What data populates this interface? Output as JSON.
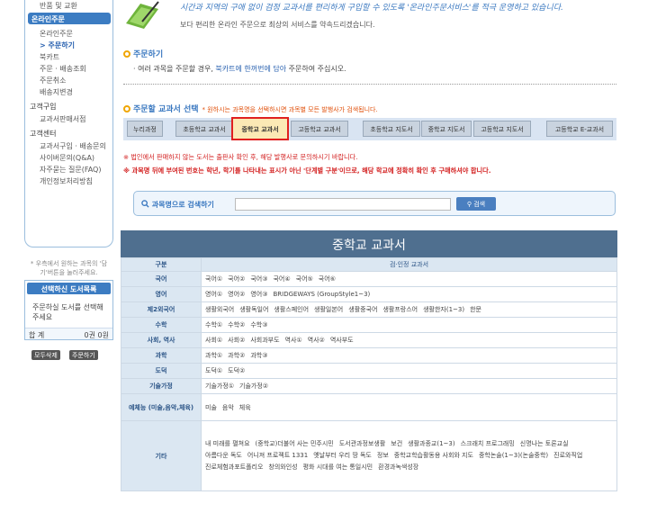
{
  "sidebar": {
    "top_label": "반품 및 교환",
    "section1": "온라인주문",
    "sub1": [
      "온라인주문",
      "> 주문하기",
      "북카트",
      "주문 · 배송조회",
      "주문취소",
      "배송지변경"
    ],
    "section2": "고객구입",
    "sub2": [
      "교과서판매서점"
    ],
    "section3": "고객센터",
    "sub3": [
      "교과서구입 · 배송문의",
      "사이버문의(Q&A)",
      "자주묻는 질문(FAQ)",
      "개인정보처리방침"
    ]
  },
  "cart": {
    "note": "* 우측에서 원하는 과목의 '담기'버튼을 눌러주세요.",
    "title": "선택하신 도서목록",
    "message": "주문하실 도서를 선택해주세요",
    "total_label": "합 계",
    "total_value": "0권  0원",
    "btn_delete": "모두삭제",
    "btn_order": "주문하기"
  },
  "header": {
    "slogan": "시간과 지역의 구애 없이 검정 교과서를 편리하게 구입할 수 있도록 '온라인주문서비스'를 적극 운영하고 있습니다.",
    "sub": "보다 편리한 온라인 주문으로 최상의 서비스를 약속드리겠습니다."
  },
  "order": {
    "title": "주문하기",
    "desc_pre": "· 여러 과목을 주문할 경우, ",
    "desc_link": "북카트에 한꺼번에 담아",
    "desc_post": " 주문하여 주십시오."
  },
  "select": {
    "title": "주문할 교과서 선택",
    "note": "* 원하시는 과목명을 선택하시면 과목별 모든 발행사가 검색됩니다."
  },
  "tabs": [
    "누리과정",
    "초등학교 교과서",
    "중학교 교과서",
    "고등학교 교과서",
    "초등학교 지도서",
    "중학교 지도서",
    "고등학교 지도서",
    "고등학교 E-교과서"
  ],
  "notices": [
    "※ 법인에서 판매하지 않는 도서는 출판사 확인 후, 해당 발행사로 문의하시기 바랍니다.",
    "※ 과목명 뒤에 부여된 번호는 학년, 학기를 나타내는 표시가 아닌 '단계별 구분'이므로, 해당 학교에 정확히 확인 후 구매하셔야 합니다."
  ],
  "search": {
    "label": "과목명으로 검색하기",
    "button": "검색"
  },
  "table": {
    "title": "중학교 교과서",
    "head": [
      "구분",
      "검·인정 교과서"
    ],
    "rows": [
      {
        "cat": "국어",
        "items": [
          "국어①",
          "국어②",
          "국어③",
          "국어④",
          "국어⑤",
          "국어⑥"
        ]
      },
      {
        "cat": "영어",
        "items": [
          "영어①",
          "영어②",
          "영어③",
          "BRIDGEWAYS (GroupStyle1~3)"
        ]
      },
      {
        "cat": "제2외국어",
        "items": [
          "생활외국어",
          "생활독일어",
          "생활스페인어",
          "생활일본어",
          "생활중국어",
          "생활프랑스어",
          "생활한자(1~3)",
          "한문"
        ]
      },
      {
        "cat": "수학",
        "items": [
          "수학①",
          "수학②",
          "수학③"
        ]
      },
      {
        "cat": "사회, 역사",
        "items": [
          "사회①",
          "사회②",
          "사회과부도",
          "역사①",
          "역사②",
          "역사부도"
        ]
      },
      {
        "cat": "과학",
        "items": [
          "과학①",
          "과학②",
          "과학③"
        ]
      },
      {
        "cat": "도덕",
        "items": [
          "도덕①",
          "도덕②"
        ]
      },
      {
        "cat": "기술가정",
        "items": [
          "기술가정①",
          "기술가정②"
        ]
      },
      {
        "cat": "예체능 (미술,음악,체육)",
        "items": [
          "미술",
          "음악",
          "체육"
        ]
      },
      {
        "cat": "기타",
        "items": [
          "내 미래를 펼쳐요",
          "(중학교)더불어 사는 민주시민",
          "도서관과정보생활",
          "보건",
          "생활과종교(1~3)",
          "스크래치 프로그래밍",
          "신명나는 토론교실",
          "아름다운 독도",
          "어니져 프로젝트 1331",
          "옛날부터 우리 땅 독도",
          "정보",
          "중학교학습활동용 사회와 지도",
          "중학논술(1~3)(논술중학)",
          "진로와직업",
          "진로체험과포트폴리오",
          "창의와인성",
          "평화 시대를 여는 통일시민",
          "환경과녹색성장"
        ]
      }
    ]
  }
}
